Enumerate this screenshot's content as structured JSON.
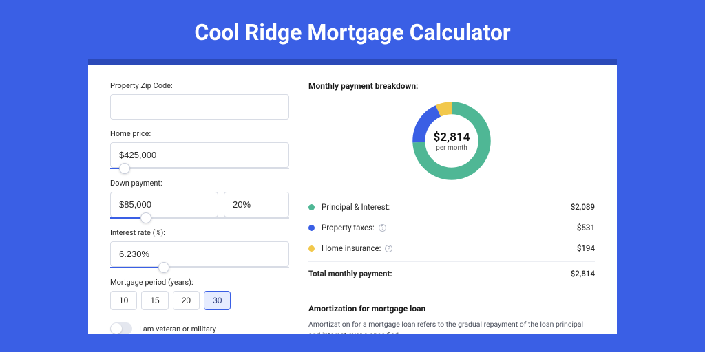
{
  "page": {
    "title": "Cool Ridge Mortgage Calculator"
  },
  "form": {
    "zip": {
      "label": "Property Zip Code:",
      "value": ""
    },
    "home_price": {
      "label": "Home price:",
      "value": "$425,000",
      "slider_pct": 8
    },
    "down_payment": {
      "label": "Down payment:",
      "value": "$85,000",
      "pct": "20%",
      "slider_pct": 20
    },
    "interest": {
      "label": "Interest rate (%):",
      "value": "6.230%",
      "slider_pct": 30
    },
    "period": {
      "label": "Mortgage period (years):",
      "options": [
        "10",
        "15",
        "20",
        "30"
      ],
      "selected": "30"
    },
    "veteran": {
      "label": "I am veteran or military",
      "value": false
    }
  },
  "breakdown": {
    "title": "Monthly payment breakdown:",
    "donut": {
      "amount": "$2,814",
      "sub": "per month"
    },
    "items": [
      {
        "color": "#4fb795",
        "label": "Principal & Interest:",
        "value": "$2,089",
        "info": false
      },
      {
        "color": "#3a5fe5",
        "label": "Property taxes:",
        "value": "$531",
        "info": true
      },
      {
        "color": "#f2c84b",
        "label": "Home insurance:",
        "value": "$194",
        "info": true
      }
    ],
    "total": {
      "label": "Total monthly payment:",
      "value": "$2,814"
    }
  },
  "amortization": {
    "title": "Amortization for mortgage loan",
    "body": "Amortization for a mortgage loan refers to the gradual repayment of the loan principal and interest over a specified"
  },
  "chart_data": {
    "type": "pie",
    "title": "Monthly payment breakdown",
    "series": [
      {
        "name": "Principal & Interest",
        "value": 2089,
        "color": "#4fb795"
      },
      {
        "name": "Property taxes",
        "value": 531,
        "color": "#3a5fe5"
      },
      {
        "name": "Home insurance",
        "value": 194,
        "color": "#f2c84b"
      }
    ],
    "total": 2814,
    "unit": "USD per month"
  }
}
